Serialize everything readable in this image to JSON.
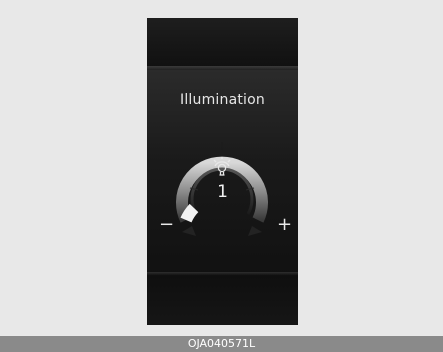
{
  "panel": {
    "title": "Illumination",
    "level": "1",
    "decrease_label": "−",
    "increase_label": "+",
    "icon": "dashboard-light-icon"
  },
  "footer": {
    "code": "OJA040571L"
  },
  "colors": {
    "background": "#e8e8e8",
    "screen": "#141414",
    "footer": "#8a8a8a"
  }
}
